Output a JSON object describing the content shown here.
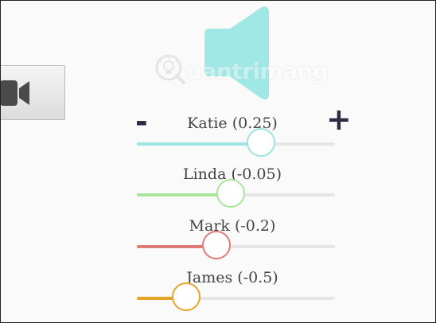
{
  "colors": {
    "speaker": "#9fe8e6",
    "camera_icon": "#4a4a4a",
    "sign_buttons": "#2b2e43"
  },
  "watermark": {
    "text": "uantrimang",
    "icon": "bulb-q-logo"
  },
  "controls": {
    "minus_label": "-",
    "plus_label": "+"
  },
  "icons": {
    "speaker": "speaker-icon",
    "camera": "video-camera-icon"
  },
  "people": [
    {
      "label": "Katie (0.25)",
      "value": 0.25,
      "color": "#9fe3e3"
    },
    {
      "label": "Linda (-0.05)",
      "value": -0.05,
      "color": "#a9e59a"
    },
    {
      "label": "Mark (-0.2)",
      "value": -0.2,
      "color": "#e07a77"
    },
    {
      "label": "James (-0.5)",
      "value": -0.5,
      "color": "#e6a626"
    }
  ]
}
